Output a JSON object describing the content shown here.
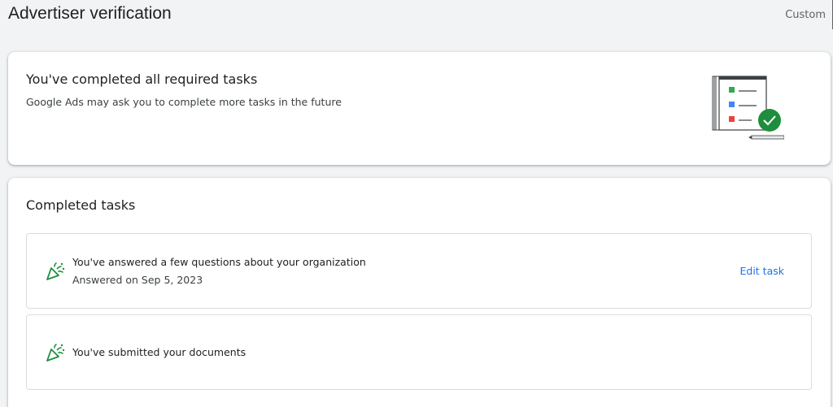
{
  "header": {
    "title": "Advertiser verification",
    "custom_label": "Custom"
  },
  "summary": {
    "title": "You've completed all required tasks",
    "subtitle": "Google Ads may ask you to complete more tasks in the future",
    "illustration": "checklist-complete-illustration"
  },
  "completed_tasks": {
    "heading": "Completed tasks",
    "items": [
      {
        "icon": "celebration-icon",
        "title": "You've answered a few questions about your organization",
        "meta": "Answered on Sep 5, 2023",
        "action_label": "Edit task"
      },
      {
        "icon": "celebration-icon",
        "title": "You've submitted your documents"
      }
    ]
  },
  "colors": {
    "accent": "#1a73e8",
    "success": "#1e8e3e",
    "background": "#f1f3f4"
  }
}
